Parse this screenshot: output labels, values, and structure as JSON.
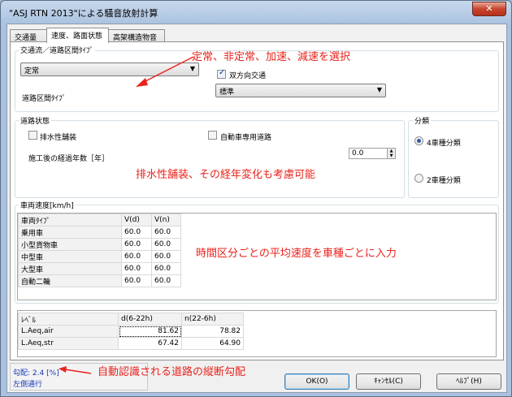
{
  "window": {
    "title": "\"ASJ RTN 2013\"による騒音放射計算",
    "close_label": "✕"
  },
  "tabs": [
    {
      "label": "交通量"
    },
    {
      "label": "速度、路面状態"
    },
    {
      "label": "高架構造物音"
    }
  ],
  "traffic_group": {
    "label": "交通流／道路区間ﾀｲﾌﾟ",
    "flow_value": "定常",
    "bidirectional_label": "双方向交通",
    "road_type_label": "道路区間ﾀｲﾌﾟ",
    "road_type_value": "標準"
  },
  "road_group": {
    "label": "道路状態",
    "porous_label": "排水性舗装",
    "motorway_label": "自動車専用道路",
    "years_label": "施工後の経過年数［年］",
    "years_value": "0.0"
  },
  "class_group": {
    "label": "分類",
    "options": [
      "4車種分類",
      "2車種分類"
    ]
  },
  "speed_group": {
    "label": "車両速度[km/h]",
    "headers": [
      "車両ﾀｲﾌﾟ",
      "V(d)",
      "V(n)"
    ],
    "rows": [
      {
        "type": "乗用車",
        "vd": "60.0",
        "vn": "60.0"
      },
      {
        "type": "小型貨物車",
        "vd": "60.0",
        "vn": "60.0"
      },
      {
        "type": "中型車",
        "vd": "60.0",
        "vn": "60.0"
      },
      {
        "type": "大型車",
        "vd": "60.0",
        "vn": "60.0"
      },
      {
        "type": "自動二輪",
        "vd": "60.0",
        "vn": "60.0"
      }
    ]
  },
  "level_table": {
    "headers": [
      "ﾚﾍﾞﾙ",
      "d(6-22h)",
      "n(22-6h)"
    ],
    "rows": [
      {
        "name": "L.Aeq,air",
        "d": "81.62",
        "n": "78.82"
      },
      {
        "name": "L.Aeq,str",
        "d": "67.42",
        "n": "64.90"
      }
    ]
  },
  "status": {
    "gradient": "勾配: 2.4 [%]",
    "side": "左側通行"
  },
  "buttons": {
    "ok": "OK(O)",
    "cancel": "ｷｬﾝｾﾙ(C)",
    "help": "ﾍﾙﾌﾟ(H)"
  },
  "annotations": {
    "flow": "定常、非定常、加速、減速を選択",
    "pavement": "排水性舗装、その経年変化も考慮可能",
    "speed": "時間区分ごとの平均速度を車種ごとに入力",
    "gradient": "自動認識される道路の縦断勾配"
  },
  "colors": {
    "annotation": "#e8231c",
    "status_text": "#1738b8"
  }
}
